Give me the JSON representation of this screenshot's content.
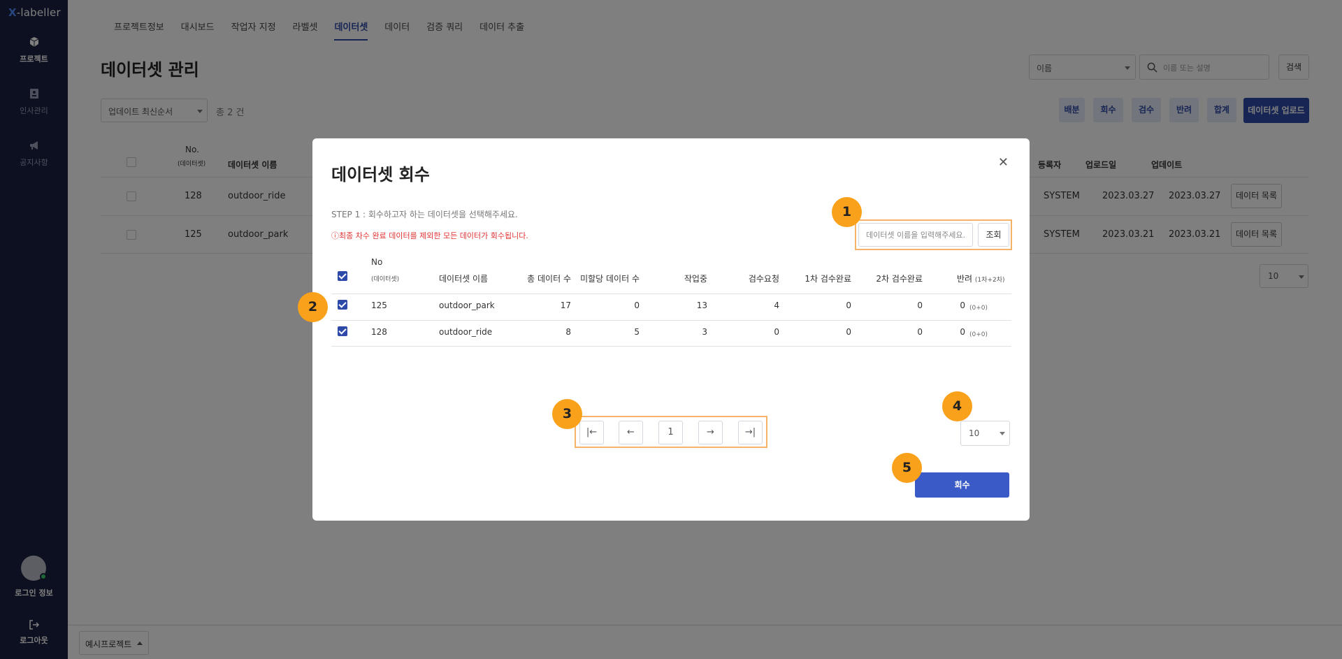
{
  "app": {
    "logo_x": "X",
    "logo_rest": "-labeller"
  },
  "sidebar": {
    "items": [
      {
        "label": "프로젝트",
        "icon": "box-icon",
        "active": true
      },
      {
        "label": "인사관리",
        "icon": "id-card-icon",
        "active": false
      },
      {
        "label": "공지사항",
        "icon": "megaphone-icon",
        "active": false
      }
    ],
    "login_label": "로그인 정보",
    "logout_label": "로그아웃"
  },
  "nav": {
    "tabs": [
      "프로젝트정보",
      "대시보드",
      "작업자 지정",
      "라벨셋",
      "데이터셋",
      "데이터",
      "검증 쿼리",
      "데이터 추출"
    ],
    "active_tab": "데이터셋"
  },
  "page": {
    "title": "데이터셋 관리",
    "search_field_select": "이름",
    "search_placeholder": "이름 또는 설명",
    "search_button": "검색",
    "sort_select": "업데이트 최신순서",
    "total_count": "총 2 건",
    "actions": [
      "배분",
      "회수",
      "검수",
      "반려",
      "합계"
    ],
    "upload_button": "데이터셋 업로드",
    "columns": {
      "no": "No.",
      "no_sub": "(데이터셋)",
      "name": "데이터셋 이름",
      "registrant": "등록자",
      "upload_date": "업로드일",
      "updated": "업데이트"
    },
    "rows": [
      {
        "no": "128",
        "name": "outdoor_ride",
        "registrant": "SYSTEM",
        "upload_date": "2023.03.27",
        "updated": "2023.03.27",
        "action": "데이터 목록"
      },
      {
        "no": "125",
        "name": "outdoor_park",
        "registrant": "SYSTEM",
        "upload_date": "2023.03.21",
        "updated": "2023.03.21",
        "action": "데이터 목록"
      }
    ],
    "page_size": "10",
    "project_select": "예시프로젝트"
  },
  "modal": {
    "title": "데이터셋 회수",
    "step_text": "STEP 1 : 회수하고자 하는 데이터셋을 선택해주세요.",
    "warning": "최종 차수 완료 데이터를 제외한 모든 데이터가 회수됩니다.",
    "search_placeholder": "데이터셋 이름을 입력해주세요.",
    "search_button": "조회",
    "columns": {
      "no": "No",
      "no_sub": "(데이터셋)",
      "name": "데이터셋 이름",
      "total": "총 데이터 수",
      "unassigned": "미할당 데이터 수",
      "in_progress": "작업중",
      "review_request": "검수요청",
      "first_review": "1차 검수완료",
      "second_review": "2차 검수완료",
      "rejected": "반려",
      "rejected_sub": "(1차+2차)"
    },
    "rows": [
      {
        "no": "125",
        "name": "outdoor_park",
        "total": "17",
        "unassigned": "0",
        "in_progress": "13",
        "review_request": "4",
        "first_review": "0",
        "second_review": "0",
        "rejected": "0",
        "rejected_sub": "(0+0)"
      },
      {
        "no": "128",
        "name": "outdoor_ride",
        "total": "8",
        "unassigned": "5",
        "in_progress": "3",
        "review_request": "0",
        "first_review": "0",
        "second_review": "0",
        "rejected": "0",
        "rejected_sub": "(0+0)"
      }
    ],
    "pager": {
      "first": "|←",
      "prev": "←",
      "current": "1",
      "next": "→",
      "last": "→|"
    },
    "page_size": "10",
    "submit": "회수"
  },
  "annotations": [
    "1",
    "2",
    "3",
    "4",
    "5"
  ],
  "colors": {
    "sidebar": "#1b2040",
    "primary": "#2e4aa8",
    "annotation": "#f9a11b",
    "highlight_border": "#f7b26a",
    "warning": "#e03131"
  }
}
